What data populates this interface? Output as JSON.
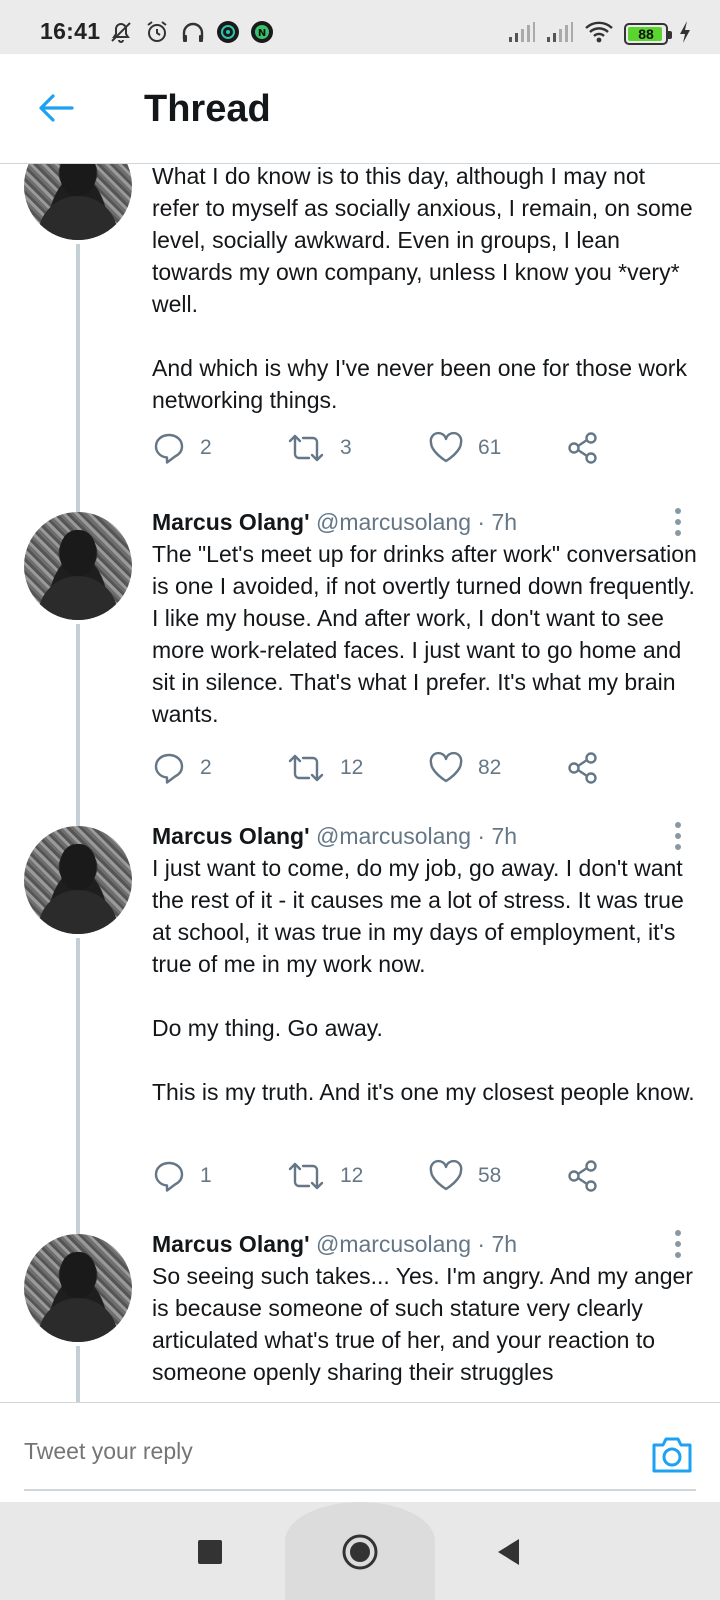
{
  "status_bar": {
    "time": "16:41",
    "battery": "88",
    "left_icons": [
      "mute-icon",
      "alarm-icon",
      "headphones-icon",
      "app-icon-1",
      "app-icon-2"
    ],
    "right_icons": [
      "signal-1-icon",
      "signal-2-icon",
      "wifi-icon",
      "battery-icon",
      "charging-icon"
    ]
  },
  "header": {
    "title": "Thread",
    "back_icon": "arrow-left-icon",
    "accent": "#1da1f2"
  },
  "tweets": [
    {
      "name": "",
      "handle": "",
      "time": "",
      "text": "What I do know is to this day, although I may not refer to myself as socially anxious, I remain, on some level, socially awkward. Even in groups, I lean towards my own company, unless I know you *very* well.\n\nAnd which is why I've never been one for those work networking things.",
      "replies": "2",
      "retweets": "3",
      "likes": "61"
    },
    {
      "name": "Marcus Olang'",
      "handle": "@marcusolang",
      "time": "· 7h",
      "text": "The \"Let's meet up for drinks after work\" conversation is one I avoided, if not overtly turned down frequently. I like my house. And after work, I don't want to see more work-related faces. I just want to go home and sit in silence. That's what I prefer. It's what my brain wants.",
      "replies": "2",
      "retweets": "12",
      "likes": "82"
    },
    {
      "name": "Marcus Olang'",
      "handle": "@marcusolang",
      "time": "· 7h",
      "text": "I just want to come, do my job, go away. I don't want the rest of it - it causes me a lot of stress. It was true at school, it was true in my days of employment, it's true of me in my work now.\n\nDo my thing. Go away.\n\nThis is my truth. And it's one my closest people know.",
      "replies": "1",
      "retweets": "12",
      "likes": "58"
    },
    {
      "name": "Marcus Olang'",
      "handle": "@marcusolang",
      "time": "· 7h",
      "text": "So seeing such takes... Yes. I'm angry. And my anger is because someone of such stature very clearly articulated what's true of her, and your reaction to someone openly sharing their struggles",
      "replies": "",
      "retweets": "",
      "likes": ""
    }
  ],
  "reply": {
    "placeholder": "Tweet your reply",
    "camera_icon": "camera-icon"
  },
  "nav": {
    "buttons": [
      "recents-button",
      "home-button",
      "back-button"
    ]
  }
}
